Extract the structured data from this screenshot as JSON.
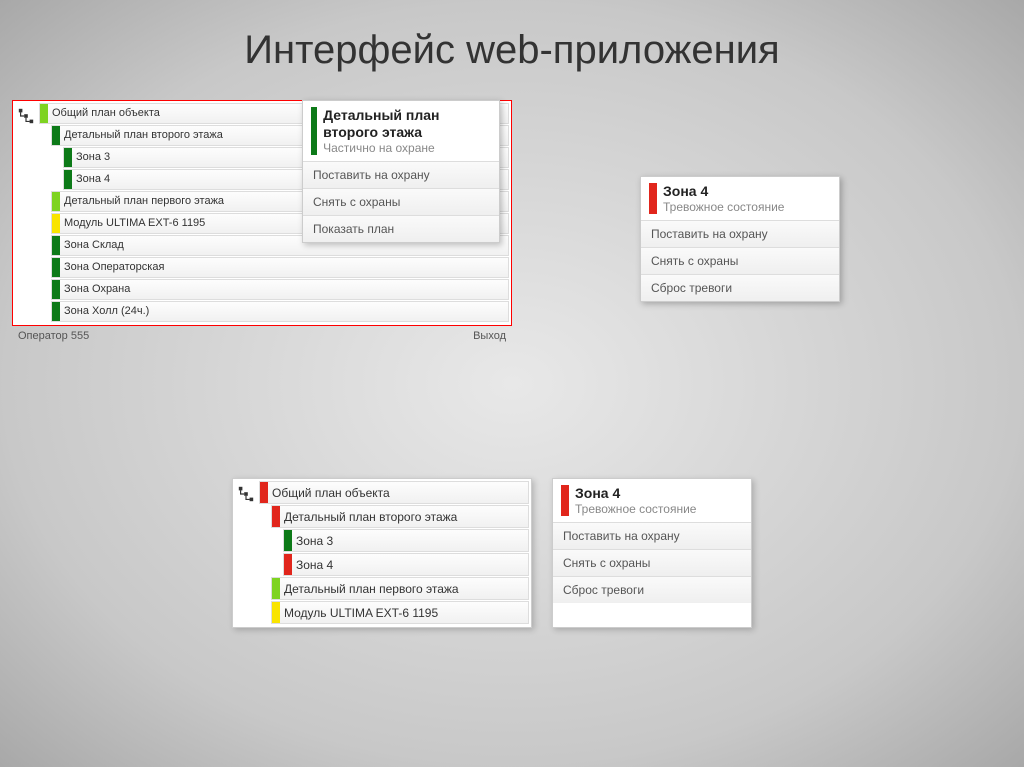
{
  "slide": {
    "title": "Интерфейс web-приложения"
  },
  "panel1": {
    "tree": [
      {
        "label": "Общий план объекта",
        "bar": "lg",
        "indent": 0
      },
      {
        "label": "Детальный план второго этажа",
        "bar": "dg",
        "indent": 1
      },
      {
        "label": "Зона 3",
        "bar": "dg",
        "indent": 2
      },
      {
        "label": "Зона 4",
        "bar": "dg",
        "indent": 2
      },
      {
        "label": "Детальный план первого этажа",
        "bar": "lg",
        "indent": 1
      },
      {
        "label": "Модуль ULTIMA EXT-6 1195",
        "bar": "y",
        "indent": 1
      },
      {
        "label": "Зона Склад",
        "bar": "dg",
        "indent": 1
      },
      {
        "label": "Зона Операторская",
        "bar": "dg",
        "indent": 1
      },
      {
        "label": "Зона Охрана",
        "bar": "dg",
        "indent": 1
      },
      {
        "label": "Зона Холл (24ч.)",
        "bar": "dg",
        "indent": 1
      }
    ],
    "footer": {
      "left": "Оператор 555",
      "right": "Выход"
    },
    "card": {
      "bar": "dg",
      "title": "Детальный план второго этажа",
      "subtitle": "Частично на охране",
      "actions": [
        "Поставить на охрану",
        "Снять с охраны",
        "Показать план"
      ]
    }
  },
  "card2": {
    "bar": "r",
    "title": "Зона 4",
    "subtitle": "Тревожное состояние",
    "actions": [
      "Поставить на охрану",
      "Снять с охраны",
      "Сброс тревоги"
    ]
  },
  "panel3": {
    "tree": [
      {
        "label": "Общий план объекта",
        "bar": "r",
        "indent": 0
      },
      {
        "label": "Детальный план второго этажа",
        "bar": "r",
        "indent": 1
      },
      {
        "label": "Зона 3",
        "bar": "dg",
        "indent": 2
      },
      {
        "label": "Зона 4",
        "bar": "r",
        "indent": 2
      },
      {
        "label": "Детальный план первого этажа",
        "bar": "lg",
        "indent": 1
      },
      {
        "label": "Модуль ULTIMA EXT-6 1195",
        "bar": "y",
        "indent": 1
      }
    ],
    "card": {
      "bar": "r",
      "title": "Зона 4",
      "subtitle": "Тревожное состояние",
      "actions": [
        "Поставить на охрану",
        "Снять с охраны",
        "Сброс тревоги"
      ]
    }
  }
}
